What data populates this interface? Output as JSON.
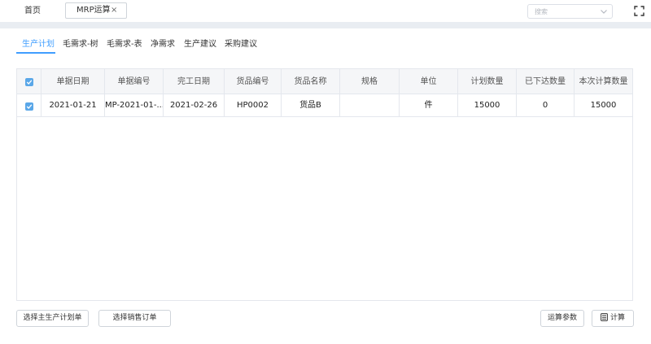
{
  "topbar": {
    "home_label": "首页",
    "open_tab_label": "MRP运算",
    "close_glyph": "×",
    "search_placeholder": "搜索"
  },
  "subtabs": [
    {
      "label": "生产计划",
      "active": true
    },
    {
      "label": "毛需求-树",
      "active": false
    },
    {
      "label": "毛需求-表",
      "active": false
    },
    {
      "label": "净需求",
      "active": false
    },
    {
      "label": "生产建议",
      "active": false
    },
    {
      "label": "采购建议",
      "active": false
    }
  ],
  "table": {
    "columns": [
      "单据日期",
      "单据编号",
      "完工日期",
      "货品编号",
      "货品名称",
      "规格",
      "单位",
      "计划数量",
      "已下达数量",
      "本次计算数量"
    ],
    "rows": [
      {
        "checked": true,
        "cells": [
          "2021-01-21",
          "MP-2021-01-...",
          "2021-02-26",
          "HP0002",
          "货品B",
          "",
          "件",
          "15000",
          "0",
          "15000"
        ]
      }
    ]
  },
  "actions": {
    "select_master_plan": "选择主生产计划单",
    "select_sales_order": "选择销售订单",
    "calc_params": "运算参数",
    "calculate": "计算"
  },
  "colors": {
    "accent": "#409eff",
    "checkbox": "#5aa7e8",
    "separator": "#e9edf2"
  },
  "icons": [
    "close-icon",
    "chevron-down-icon",
    "fullscreen-icon",
    "check-icon",
    "calculator-icon"
  ]
}
